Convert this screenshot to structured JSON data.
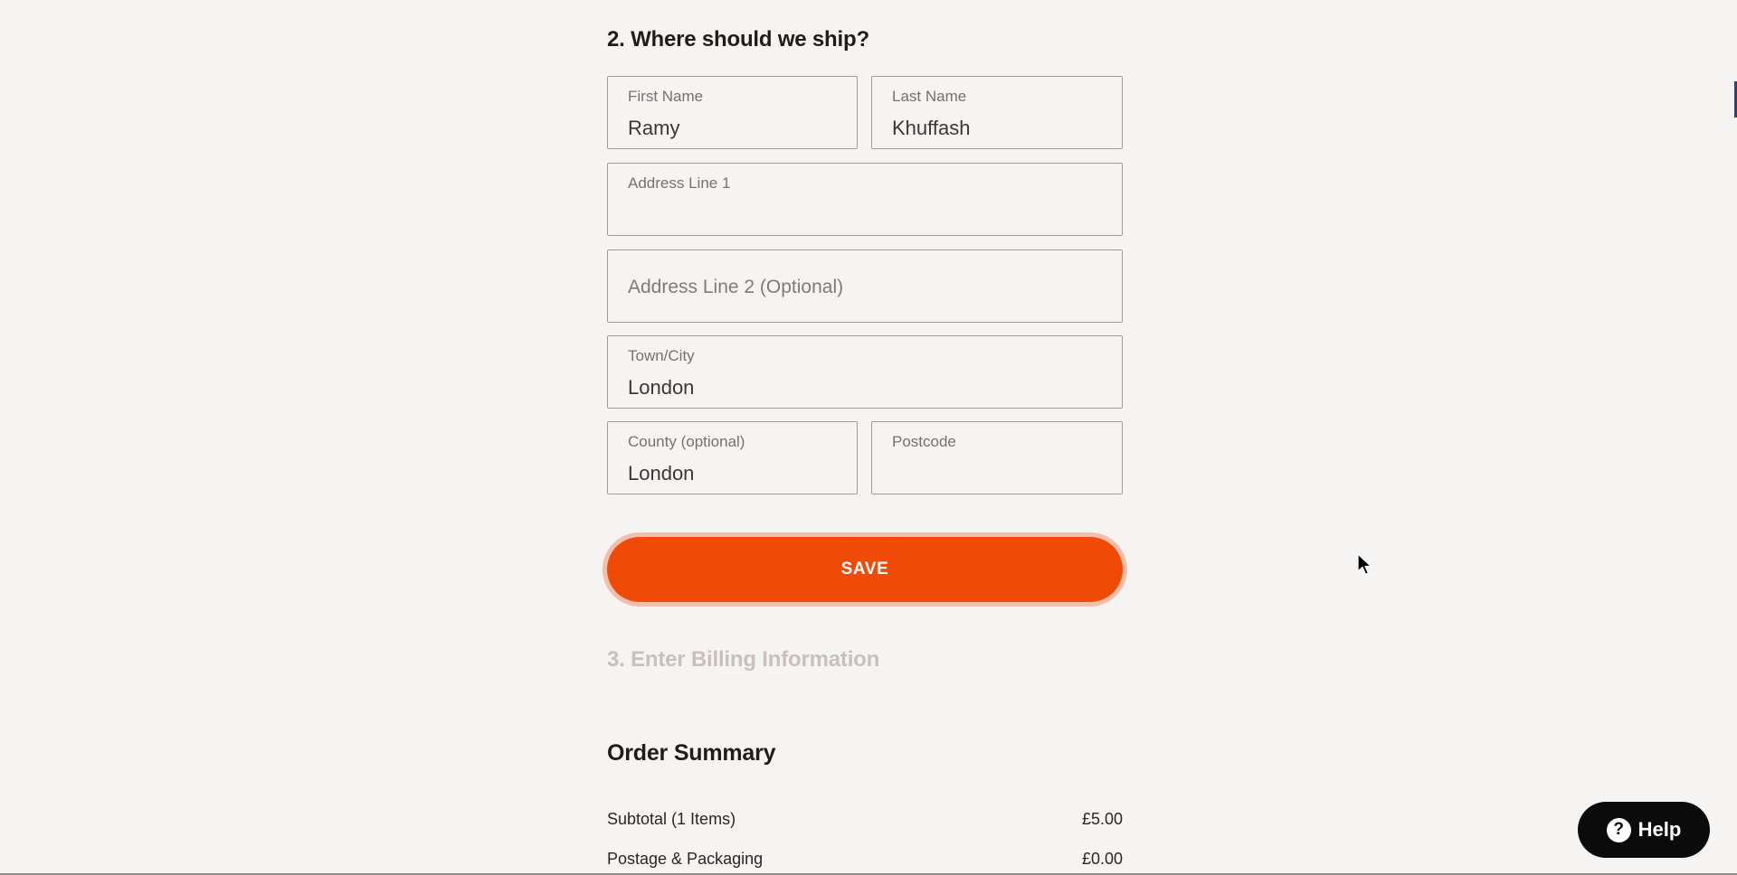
{
  "shipping": {
    "section_title": "2. Where should we ship?",
    "first_name": {
      "label": "First Name",
      "value": "Ramy"
    },
    "last_name": {
      "label": "Last Name",
      "value": "Khuffash"
    },
    "address_line_1": {
      "label": "Address Line 1",
      "value": ""
    },
    "address_line_2": {
      "placeholder": "Address Line 2 (Optional)"
    },
    "town_city": {
      "label": "Town/City",
      "value": "London"
    },
    "county": {
      "label": "County (optional)",
      "value": "London"
    },
    "postcode": {
      "label": "Postcode",
      "value": ""
    },
    "save_label": "SAVE"
  },
  "billing": {
    "section_title": "3. Enter Billing Information"
  },
  "order_summary": {
    "title": "Order Summary",
    "rows": [
      {
        "label": "Subtotal (1 Items)",
        "value": "£5.00"
      },
      {
        "label": "Postage & Packaging",
        "value": "£0.00"
      }
    ]
  },
  "help": {
    "label": "Help",
    "icon": "question-mark-icon"
  },
  "colors": {
    "accent": "#ef4a07",
    "background": "#f6f4f2",
    "help_button": "#0b0b0b"
  }
}
